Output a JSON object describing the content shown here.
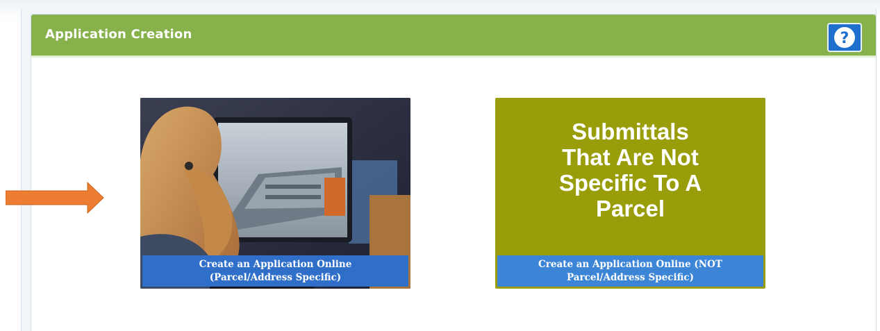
{
  "panel": {
    "title": "Application Creation",
    "help_icon": "question-circle-icon",
    "header_color": "#86b14b"
  },
  "tiles": [
    {
      "image": "woman-at-computer-photo",
      "caption_line1": "Create an Application Online",
      "caption_line2": "(Parcel/Address Specific)"
    },
    {
      "heading_lines": [
        "Submittals",
        "That Are Not",
        "Specific To A",
        "Parcel"
      ],
      "caption_line1": "Create an Application Online (NOT",
      "caption_line2": "Parcel/Address Specific)",
      "background_color": "#9a9d0a"
    }
  ],
  "annotation": {
    "arrow_icon": "right-arrow-icon",
    "arrow_color": "#ed7d31"
  }
}
